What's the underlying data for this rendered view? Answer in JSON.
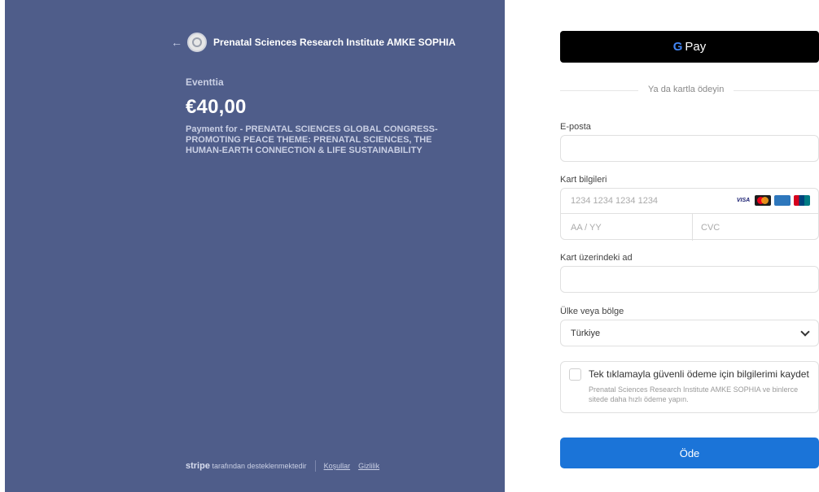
{
  "header": {
    "back_arrow": "←",
    "organization": "Prenatal Sciences Research Institute AMKE SOPHIA"
  },
  "summary": {
    "merchant": "Eventtia",
    "amount": "€40,00",
    "description": "Payment for - PRENATAL SCIENCES GLOBAL CONGRESS- PROMOTING PEACE THEME: PRENATAL SCIENCES, THE HUMAN-EARTH CONNECTION & LIFE SUSTAINABILITY"
  },
  "footer": {
    "stripe": "stripe",
    "powered_text": "tarafından desteklenmektedir",
    "terms": "Koşullar",
    "privacy": "Gizlilik"
  },
  "gpay": {
    "g": "G",
    "pay": "Pay"
  },
  "divider": {
    "text": "Ya da kartla ödeyin"
  },
  "form": {
    "email_label": "E-posta",
    "email_value": "",
    "card_label": "Kart bilgileri",
    "card_number_placeholder": "1234 1234 1234 1234",
    "expiry_placeholder": "AA / YY",
    "cvc_placeholder": "CVC",
    "card_brands": [
      "VISA",
      "mastercard",
      "amex",
      "unionpay"
    ],
    "name_label": "Kart üzerindeki ad",
    "name_value": "",
    "country_label": "Ülke veya bölge",
    "country_value": "Türkiye"
  },
  "save": {
    "title": "Tek tıklamayla güvenli ödeme için bilgilerimi kaydet",
    "subtitle": "Prenatal Sciences Research Institute AMKE SOPHIA ve binlerce sitede daha hızlı ödeme yapın."
  },
  "pay_button": {
    "label": "Öde"
  },
  "colors": {
    "left_panel": "#4f5d8a",
    "pay_button": "#1b74d8",
    "gpay_button": "#000000"
  }
}
